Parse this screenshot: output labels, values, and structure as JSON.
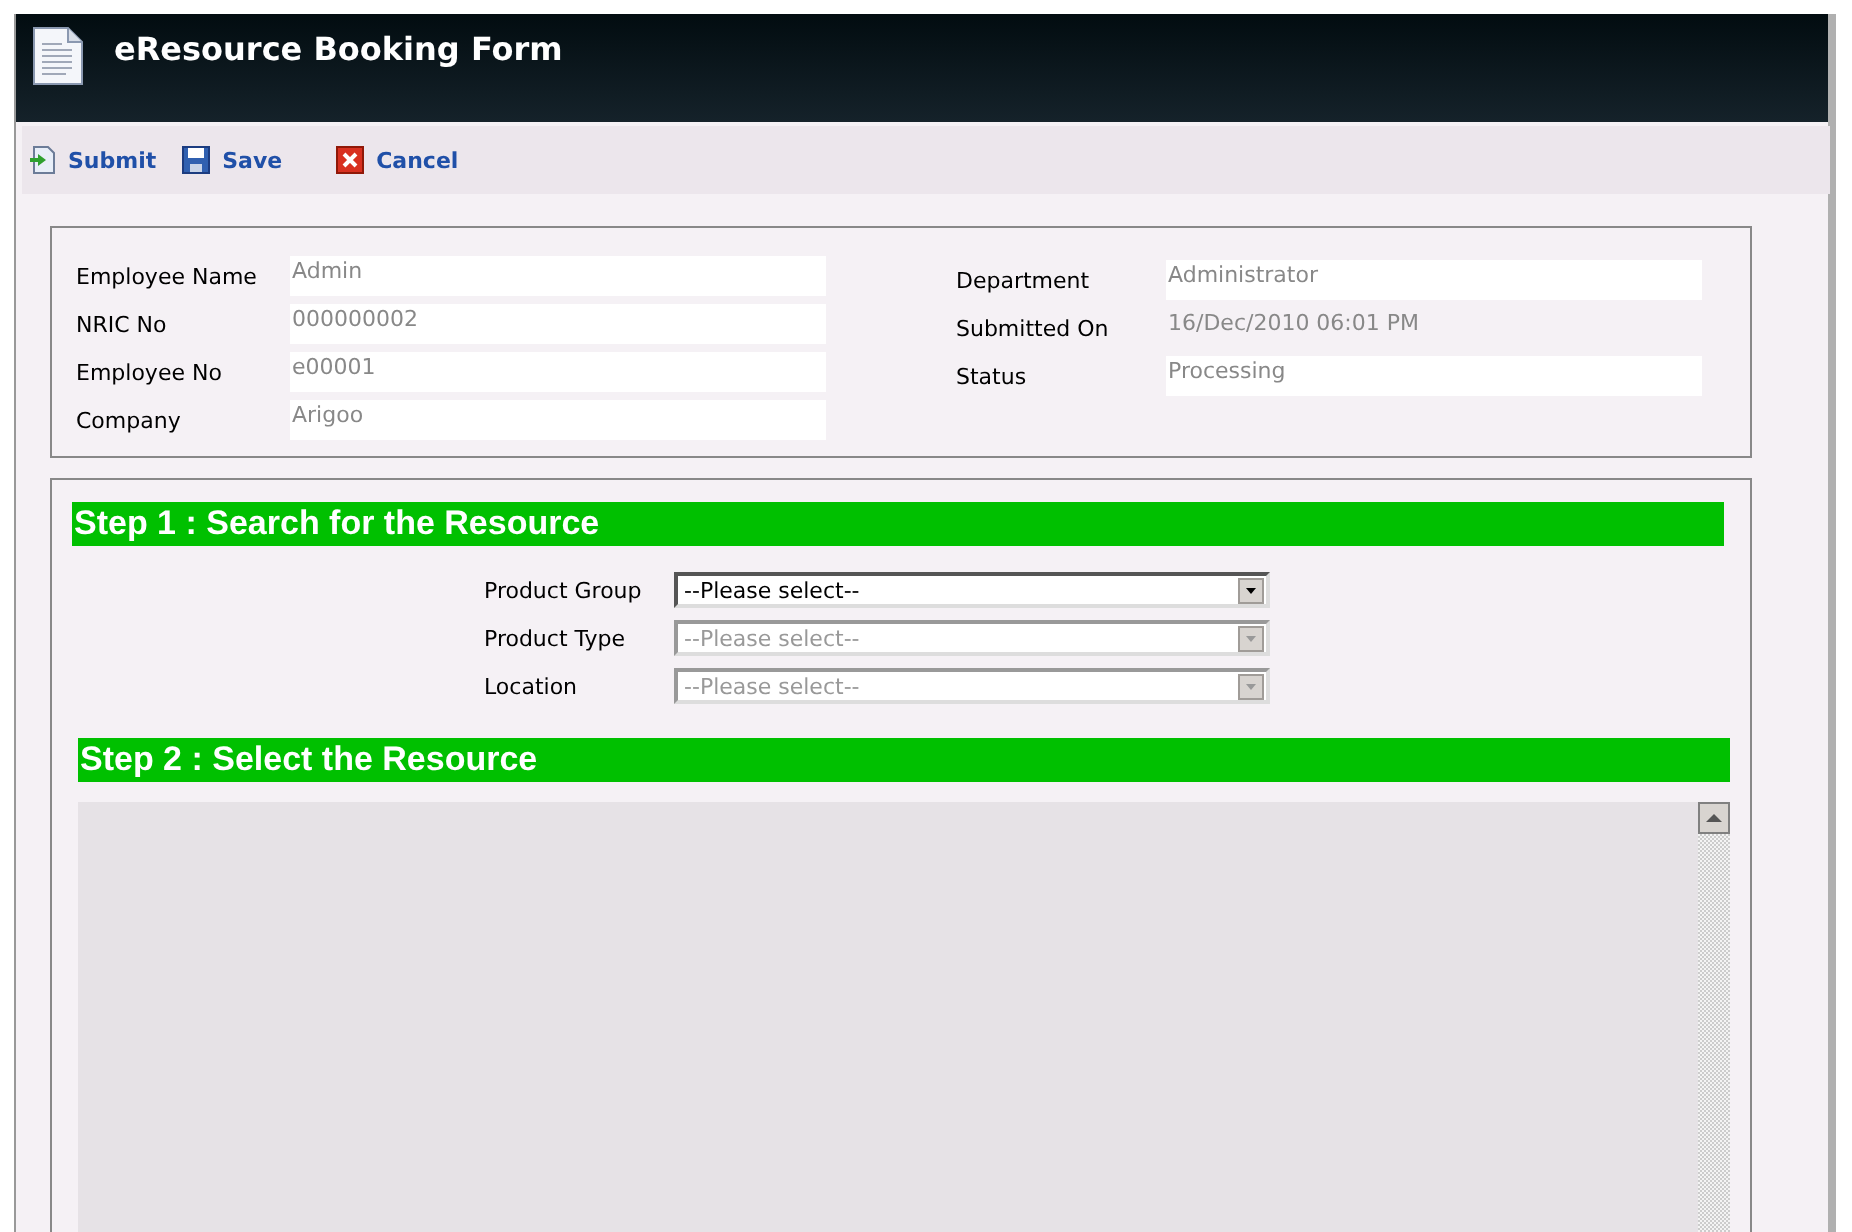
{
  "window": {
    "title": "eResource Booking Form"
  },
  "toolbar": [
    {
      "kind": "submit",
      "label": "Submit"
    },
    {
      "kind": "save",
      "label": "Save"
    },
    {
      "kind": "cancel",
      "label": "Cancel"
    }
  ],
  "employee": {
    "left": [
      {
        "label": "Employee Name",
        "value": "Admin",
        "boxed": true
      },
      {
        "label": "NRIC No",
        "value": "000000002",
        "boxed": true
      },
      {
        "label": "Employee No",
        "value": "e00001",
        "boxed": true
      },
      {
        "label": "Company",
        "value": "Arigoo",
        "boxed": true
      }
    ],
    "right": [
      {
        "label": "Department",
        "value": "Administrator",
        "boxed": true
      },
      {
        "label": "Submitted On",
        "value": "16/Dec/2010 06:01 PM",
        "boxed": false
      },
      {
        "label": "Status",
        "value": "Processing",
        "boxed": true
      }
    ]
  },
  "step1": {
    "title": "Step 1 : Search for the Resource",
    "fields": [
      {
        "label": "Product Group",
        "value": "--Please select--",
        "disabled": false
      },
      {
        "label": "Product Type",
        "value": "--Please select--",
        "disabled": true
      },
      {
        "label": "Location",
        "value": "--Please select--",
        "disabled": true
      }
    ]
  },
  "step2": {
    "title": "Step 2 : Select the Resource"
  }
}
